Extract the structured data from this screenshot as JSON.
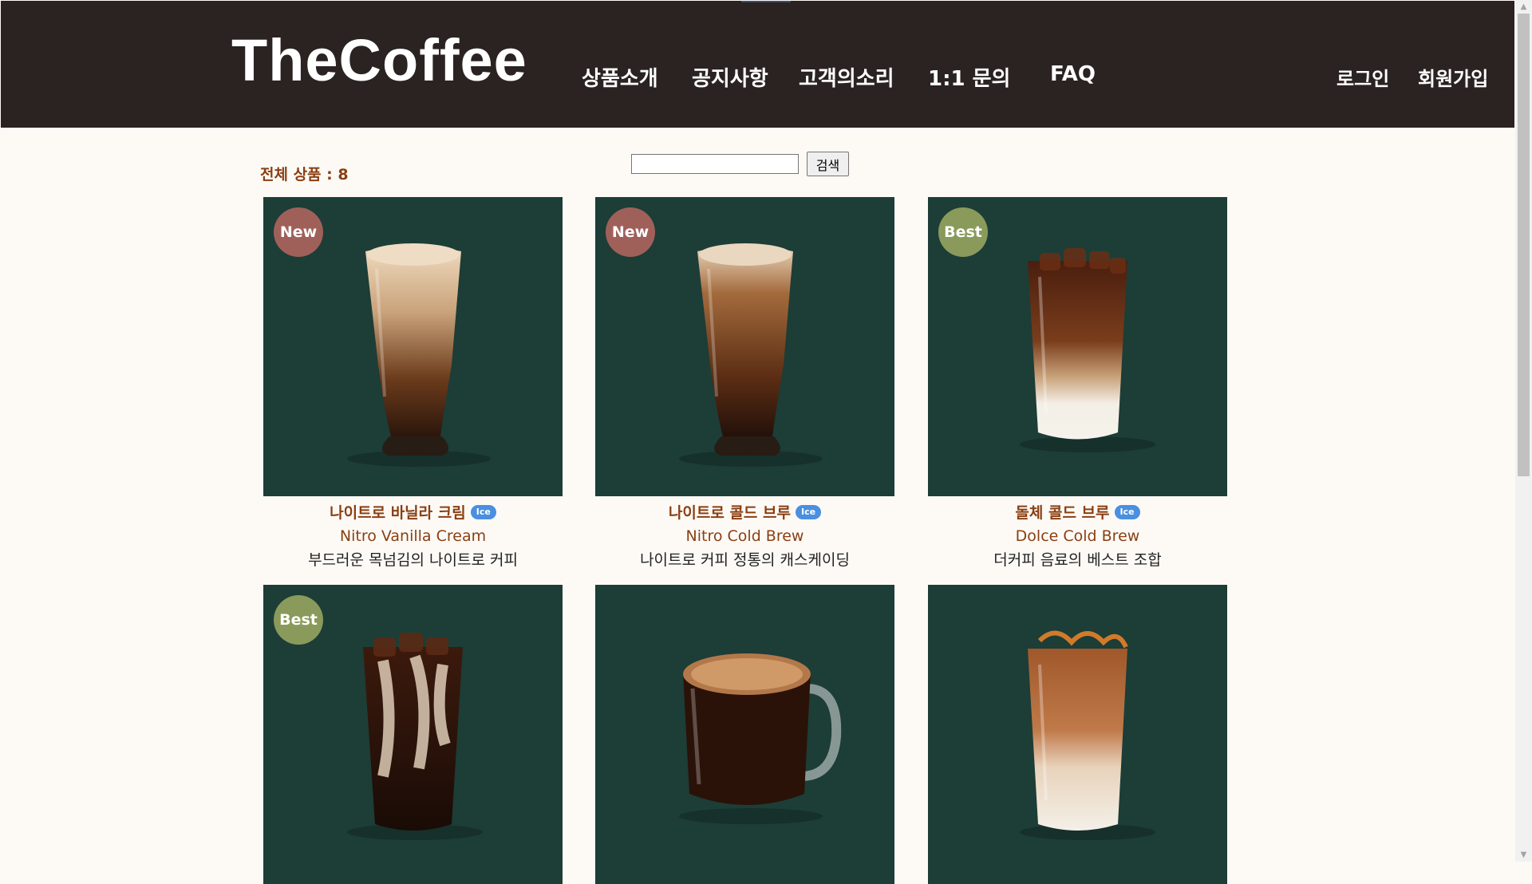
{
  "header": {
    "logo": "TheCoffee",
    "nav": [
      "상품소개",
      "공지사항",
      "고객의소리",
      "1:1 문의",
      "FAQ"
    ],
    "login": "로그인",
    "signup": "회원가입"
  },
  "listing": {
    "total_label": "전체 상품 : 8",
    "search_placeholder": "",
    "search_button": "검색"
  },
  "products": [
    {
      "badge": "New",
      "name": "나이트로 바닐라 크림",
      "tag": "Ice",
      "eng": "Nitro Vanilla Cream",
      "desc": "부드러운 목넘김의 나이트로 커피"
    },
    {
      "badge": "New",
      "name": "나이트로 콜드 브루",
      "tag": "Ice",
      "eng": "Nitro Cold Brew",
      "desc": "나이트로 커피 정통의 캐스케이딩"
    },
    {
      "badge": "Best",
      "name": "돌체 콜드 브루",
      "tag": "Ice",
      "eng": "Dolce Cold Brew",
      "desc": "더커피 음료의 베스트 조합"
    },
    {
      "badge": "Best",
      "name": "",
      "tag": "",
      "eng": "",
      "desc": ""
    },
    {
      "badge": "",
      "name": "",
      "tag": "",
      "eng": "",
      "desc": ""
    },
    {
      "badge": "",
      "name": "",
      "tag": "",
      "eng": "",
      "desc": ""
    }
  ],
  "colors": {
    "header_bg": "#2a2321",
    "card_bg": "#1d3d37",
    "title_brown": "#8a3f12",
    "badge_new": "#a0605a",
    "badge_best": "#8a9a5b",
    "ice_blue": "#4a8fe0"
  }
}
